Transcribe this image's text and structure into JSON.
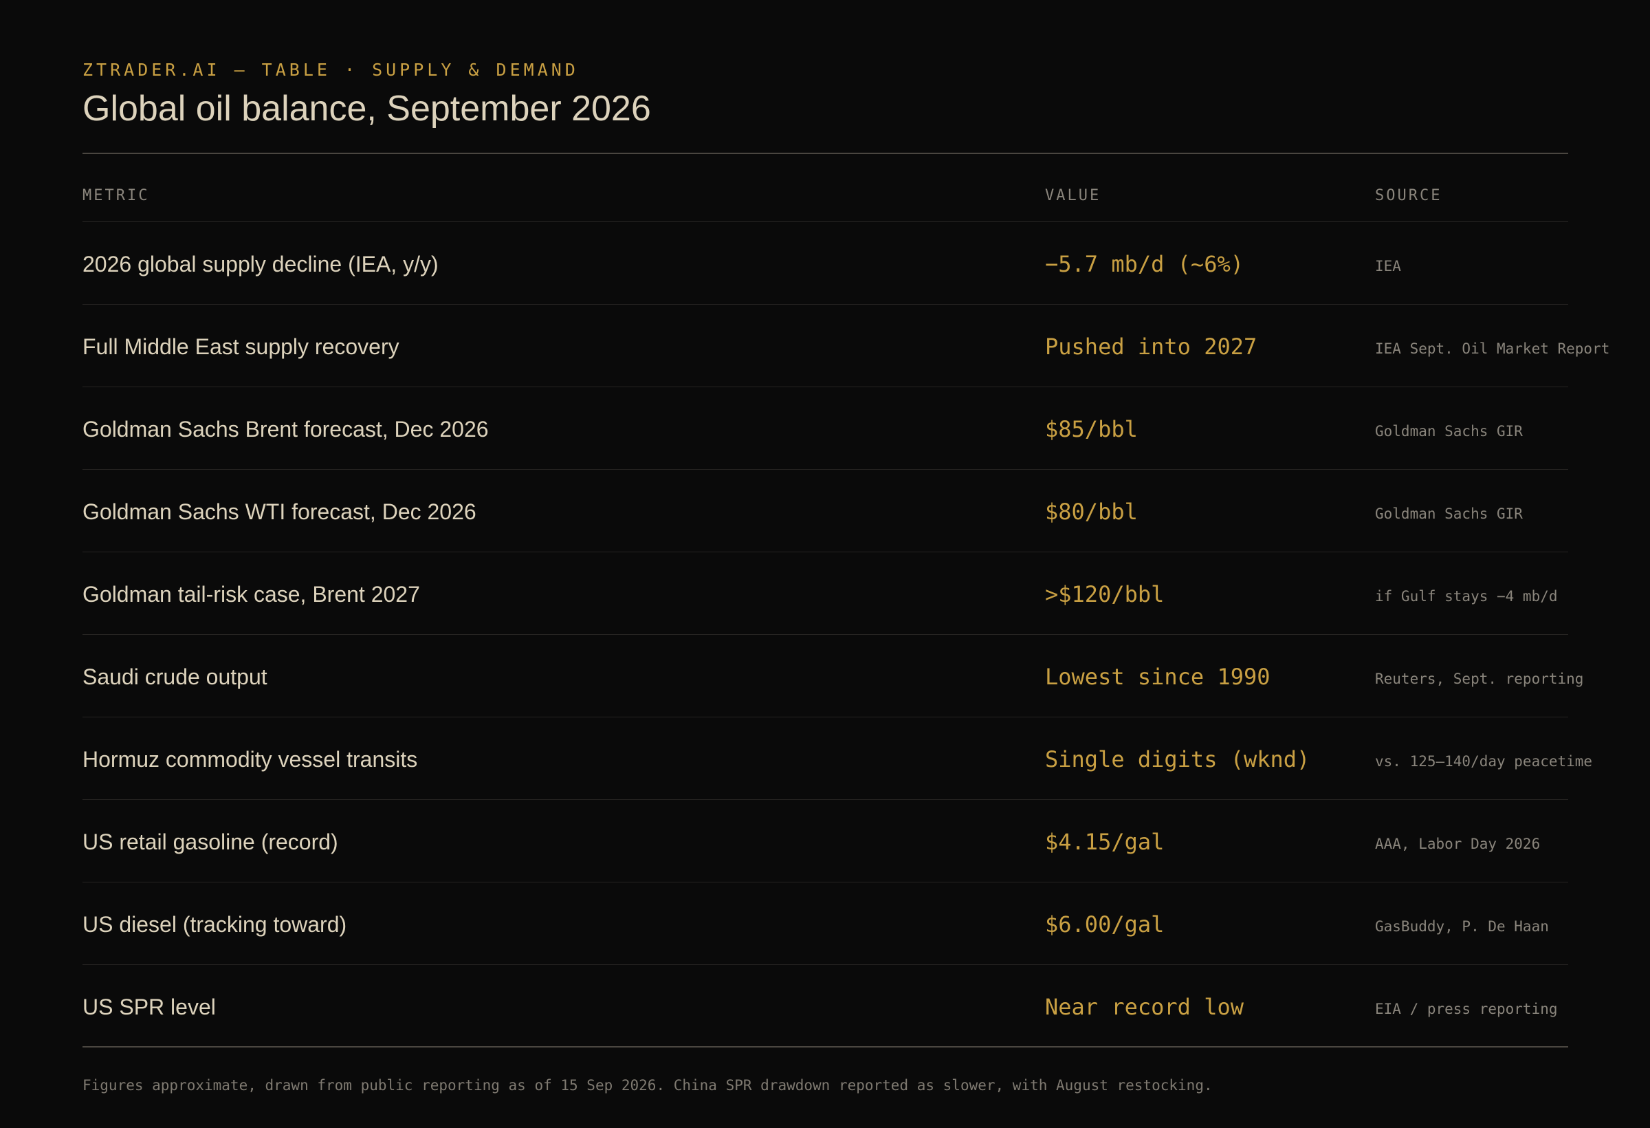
{
  "header": {
    "kicker": "ZTRADER.AI — TABLE · SUPPLY & DEMAND",
    "title": "Global oil balance, September 2026"
  },
  "table": {
    "columns": {
      "metric": "METRIC",
      "value": "VALUE",
      "source": "SOURCE"
    },
    "rows": [
      {
        "metric": "2026 global supply decline (IEA, y/y)",
        "value": "−5.7 mb/d (~6%)",
        "source": "IEA"
      },
      {
        "metric": "Full Middle East supply recovery",
        "value": "Pushed into 2027",
        "source": "IEA Sept. Oil Market Report"
      },
      {
        "metric": "Goldman Sachs Brent forecast, Dec 2026",
        "value": "$85/bbl",
        "source": "Goldman Sachs GIR"
      },
      {
        "metric": "Goldman Sachs WTI forecast, Dec 2026",
        "value": "$80/bbl",
        "source": "Goldman Sachs GIR"
      },
      {
        "metric": "Goldman tail-risk case, Brent 2027",
        "value": ">$120/bbl",
        "source": "if Gulf stays −4 mb/d"
      },
      {
        "metric": "Saudi crude output",
        "value": "Lowest since 1990",
        "source": "Reuters, Sept. reporting"
      },
      {
        "metric": "Hormuz commodity vessel transits",
        "value": "Single digits (wknd)",
        "source": "vs. 125–140/day peacetime"
      },
      {
        "metric": "US retail gasoline (record)",
        "value": "$4.15/gal",
        "source": "AAA, Labor Day 2026"
      },
      {
        "metric": "US diesel (tracking toward)",
        "value": "$6.00/gal",
        "source": "GasBuddy, P. De Haan"
      },
      {
        "metric": "US SPR level",
        "value": "Near record low",
        "source": "EIA / press reporting"
      }
    ]
  },
  "footnote": "Figures approximate, drawn from public reporting as of 15 Sep 2026. China SPR drawdown reported as slower, with August restocking.",
  "colors": {
    "background": "#0a0a0a",
    "accent": "#c9a043",
    "text": "#ddd3bc",
    "muted": "#8a857c"
  }
}
